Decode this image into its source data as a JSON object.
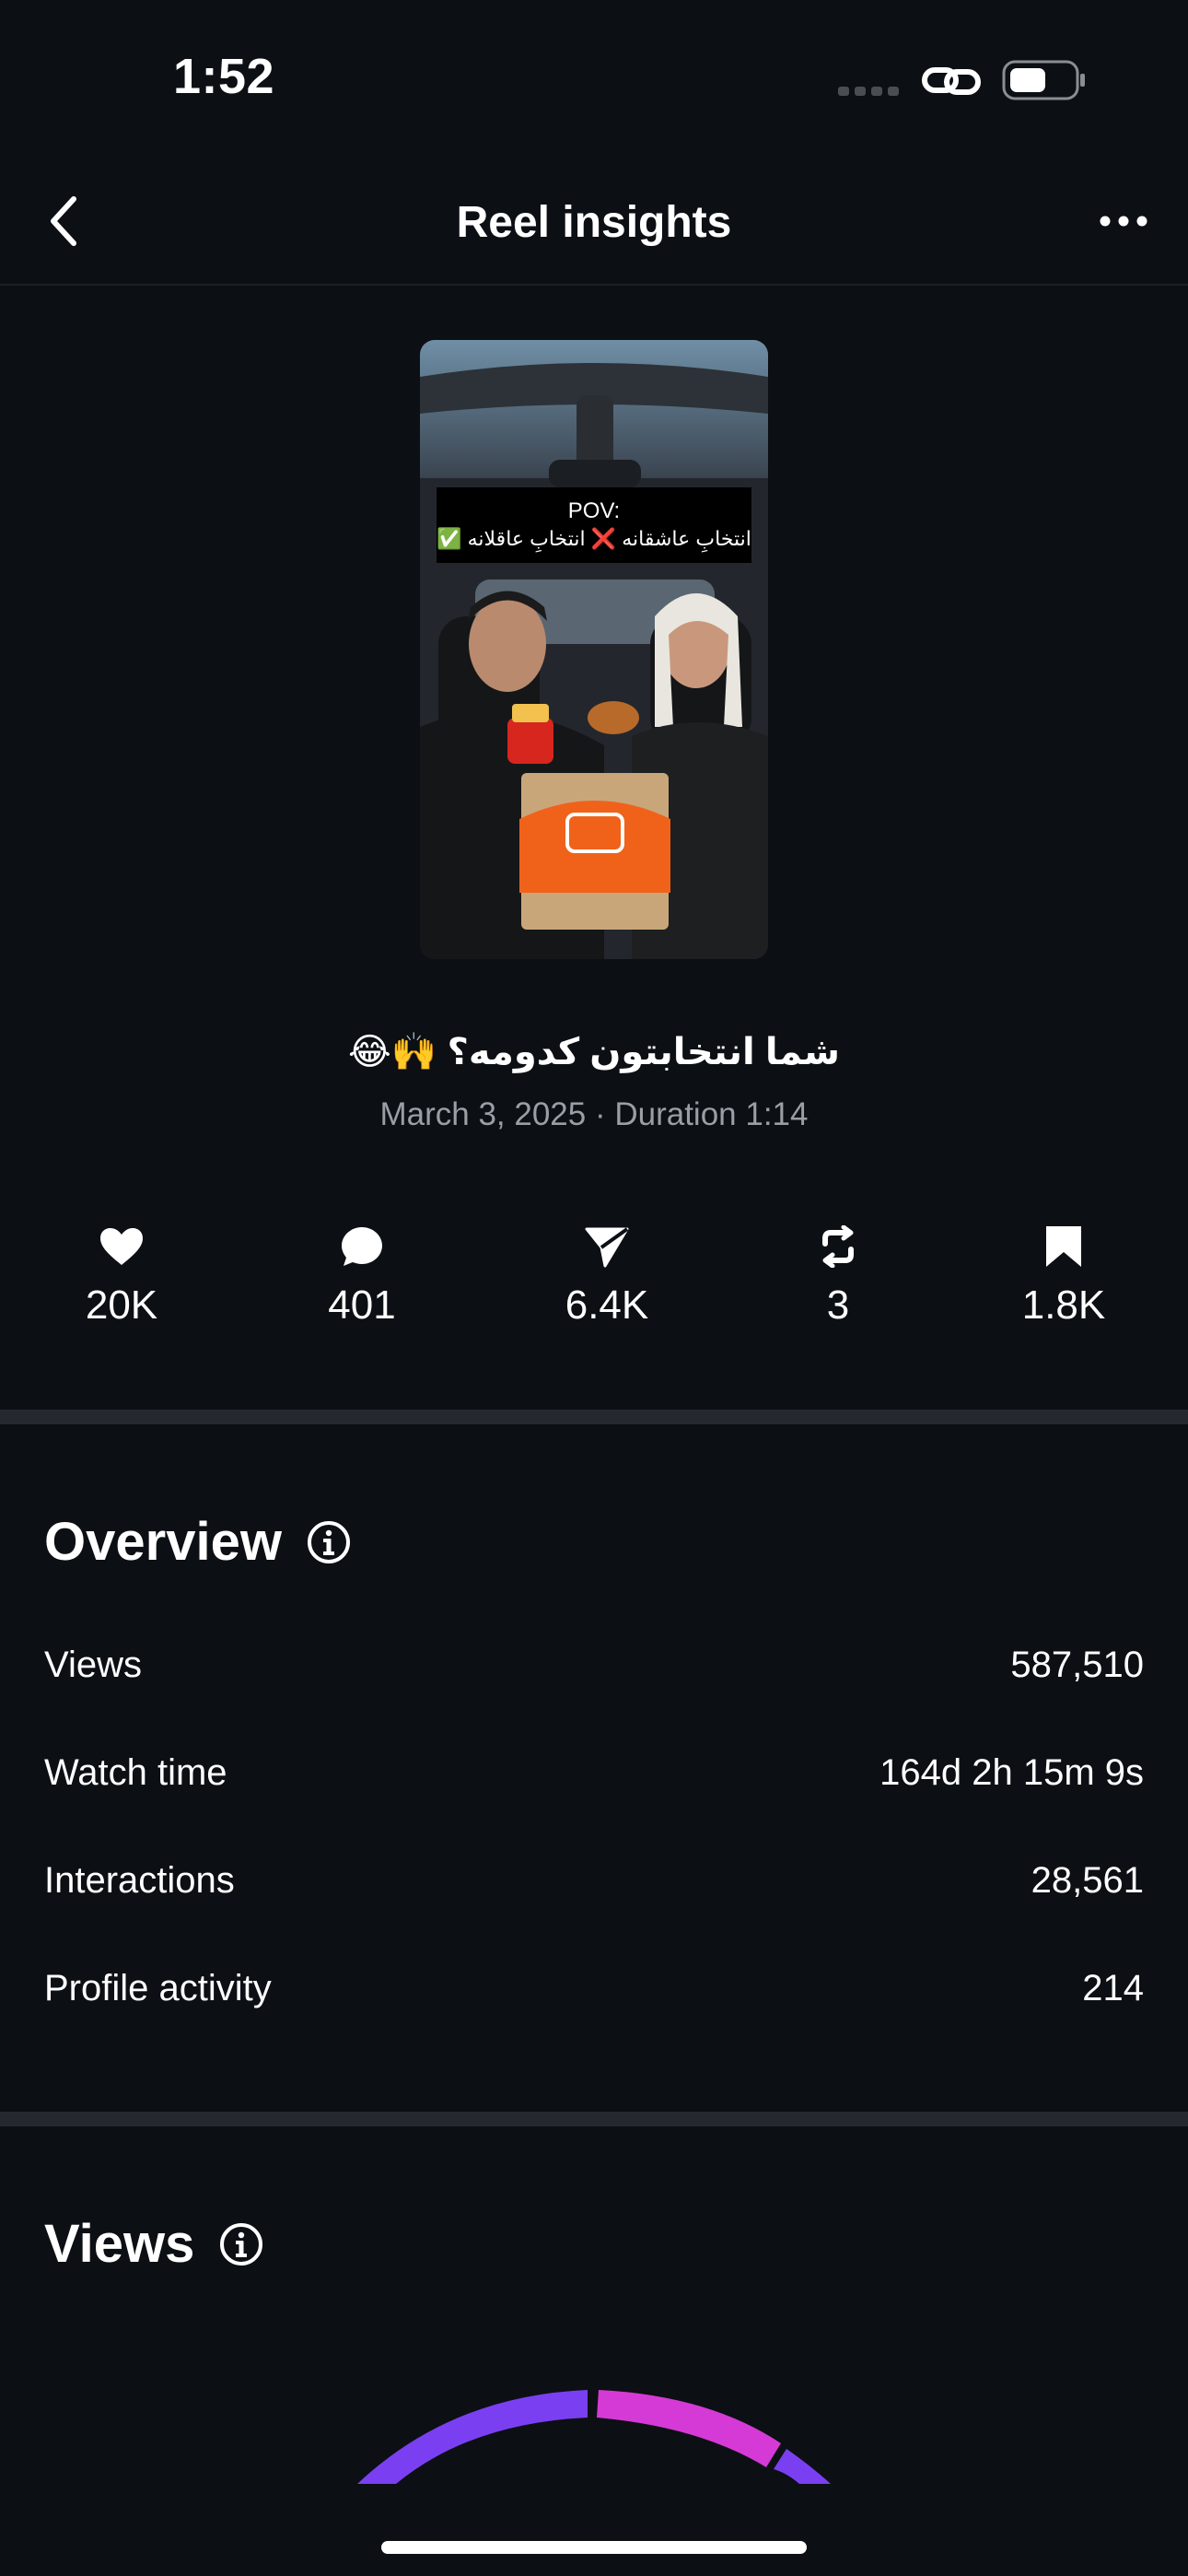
{
  "status_bar": {
    "time": "1:52"
  },
  "nav": {
    "title": "Reel insights"
  },
  "reel": {
    "overlay_pov": "POV:",
    "overlay_line": "انتخابِ عاشقانه ❌ انتخابِ عاقلانه ✅",
    "caption": "شما انتخابتون کدومه؟ 🙌😂",
    "date": "March 3, 2025",
    "duration_label": "Duration 1:14",
    "meta": "March 3, 2025 · Duration 1:14"
  },
  "stats": {
    "likes": "20K",
    "comments": "401",
    "shares": "6.4K",
    "reposts": "3",
    "saves": "1.8K"
  },
  "overview": {
    "title": "Overview",
    "rows": [
      {
        "label": "Views",
        "value": "587,510"
      },
      {
        "label": "Watch time",
        "value": "164d 2h 15m 9s"
      },
      {
        "label": "Interactions",
        "value": "28,561"
      },
      {
        "label": "Profile activity",
        "value": "214"
      }
    ]
  },
  "views_section": {
    "title": "Views"
  },
  "colors": {
    "background": "#0c0f14",
    "divider": "#25282e",
    "secondary_text": "#9a9ea5",
    "gauge_purple": "#7b3ff2",
    "gauge_pink": "#d53ad6"
  }
}
